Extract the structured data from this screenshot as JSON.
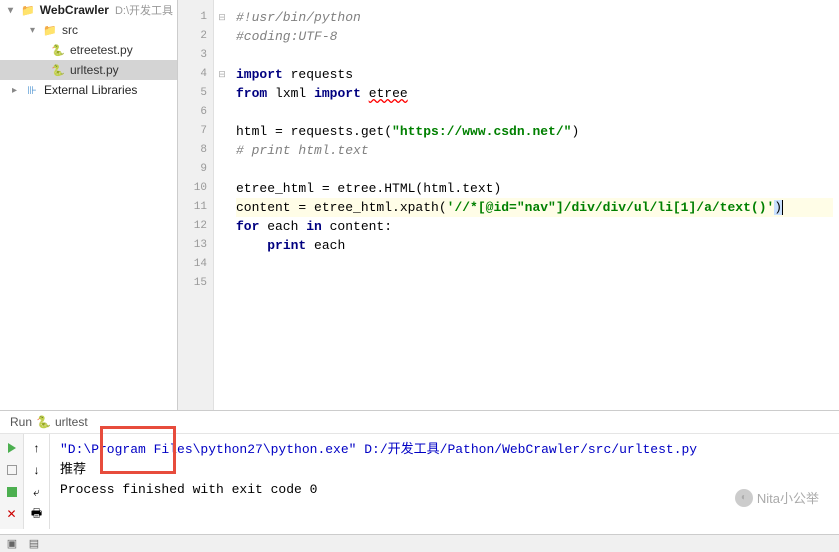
{
  "project": {
    "name": "WebCrawler",
    "path": "D:\\开发工具",
    "src_folder": "src",
    "files": [
      "etreetest.py",
      "urltest.py"
    ],
    "selected_file": "urltest.py",
    "external_libs": "External Libraries"
  },
  "editor": {
    "lines": [
      {
        "n": 1,
        "type": "comment",
        "text": "#!usr/bin/python"
      },
      {
        "n": 2,
        "type": "comment",
        "text": "#coding:UTF-8"
      },
      {
        "n": 3,
        "type": "blank",
        "text": ""
      },
      {
        "n": 4,
        "type": "import1"
      },
      {
        "n": 5,
        "type": "import2"
      },
      {
        "n": 6,
        "type": "blank",
        "text": ""
      },
      {
        "n": 7,
        "type": "assign_html"
      },
      {
        "n": 8,
        "type": "comment",
        "text": "# print html.text"
      },
      {
        "n": 9,
        "type": "blank",
        "text": ""
      },
      {
        "n": 10,
        "type": "assign_etree"
      },
      {
        "n": 11,
        "type": "assign_content"
      },
      {
        "n": 12,
        "type": "for_loop"
      },
      {
        "n": 13,
        "type": "print_each"
      },
      {
        "n": 14,
        "type": "blank",
        "text": ""
      },
      {
        "n": 15,
        "type": "blank",
        "text": ""
      }
    ],
    "kw_import": "import",
    "kw_from": "from",
    "kw_for": "for",
    "kw_in": "in",
    "kw_print": "print",
    "id_requests": "requests",
    "id_lxml": "lxml",
    "id_etree": "etree",
    "str_url": "\"https://www.csdn.net/\"",
    "str_xpath": "'//*[@id=\"nav\"]/div/div/ul/li[1]/a/text()'",
    "line10_text": "etree_html = etree.HTML(html.text)",
    "line11_prefix": "content = etree_html.xpath(",
    "line11_suffix": ")",
    "line12_each": " each ",
    "line12_content": " content:",
    "line13_each": " each"
  },
  "run": {
    "tab_label": "Run",
    "config_name": "urltest",
    "output_cmd": "\"D:\\Program Files\\python27\\python.exe\"",
    "output_args": " D:/开发工具/Pathon/WebCrawler/src/urltest.py",
    "result_line": "推荐",
    "exit_line": "Process finished with exit code 0"
  },
  "watermark": "Nita小公举"
}
